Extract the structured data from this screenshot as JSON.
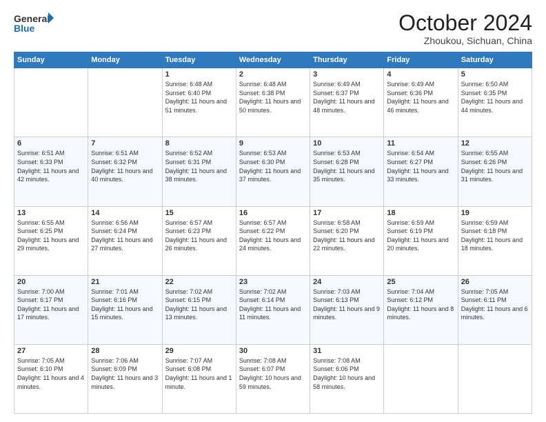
{
  "header": {
    "logo_line1": "General",
    "logo_line2": "Blue",
    "month": "October 2024",
    "location": "Zhoukou, Sichuan, China"
  },
  "days_of_week": [
    "Sunday",
    "Monday",
    "Tuesday",
    "Wednesday",
    "Thursday",
    "Friday",
    "Saturday"
  ],
  "weeks": [
    [
      {
        "day": "",
        "info": ""
      },
      {
        "day": "",
        "info": ""
      },
      {
        "day": "1",
        "info": "Sunrise: 6:48 AM\nSunset: 6:40 PM\nDaylight: 11 hours and 51 minutes."
      },
      {
        "day": "2",
        "info": "Sunrise: 6:48 AM\nSunset: 6:38 PM\nDaylight: 11 hours and 50 minutes."
      },
      {
        "day": "3",
        "info": "Sunrise: 6:49 AM\nSunset: 6:37 PM\nDaylight: 11 hours and 48 minutes."
      },
      {
        "day": "4",
        "info": "Sunrise: 6:49 AM\nSunset: 6:36 PM\nDaylight: 11 hours and 46 minutes."
      },
      {
        "day": "5",
        "info": "Sunrise: 6:50 AM\nSunset: 6:35 PM\nDaylight: 11 hours and 44 minutes."
      }
    ],
    [
      {
        "day": "6",
        "info": "Sunrise: 6:51 AM\nSunset: 6:33 PM\nDaylight: 11 hours and 42 minutes."
      },
      {
        "day": "7",
        "info": "Sunrise: 6:51 AM\nSunset: 6:32 PM\nDaylight: 11 hours and 40 minutes."
      },
      {
        "day": "8",
        "info": "Sunrise: 6:52 AM\nSunset: 6:31 PM\nDaylight: 11 hours and 38 minutes."
      },
      {
        "day": "9",
        "info": "Sunrise: 6:53 AM\nSunset: 6:30 PM\nDaylight: 11 hours and 37 minutes."
      },
      {
        "day": "10",
        "info": "Sunrise: 6:53 AM\nSunset: 6:28 PM\nDaylight: 11 hours and 35 minutes."
      },
      {
        "day": "11",
        "info": "Sunrise: 6:54 AM\nSunset: 6:27 PM\nDaylight: 11 hours and 33 minutes."
      },
      {
        "day": "12",
        "info": "Sunrise: 6:55 AM\nSunset: 6:26 PM\nDaylight: 11 hours and 31 minutes."
      }
    ],
    [
      {
        "day": "13",
        "info": "Sunrise: 6:55 AM\nSunset: 6:25 PM\nDaylight: 11 hours and 29 minutes."
      },
      {
        "day": "14",
        "info": "Sunrise: 6:56 AM\nSunset: 6:24 PM\nDaylight: 11 hours and 27 minutes."
      },
      {
        "day": "15",
        "info": "Sunrise: 6:57 AM\nSunset: 6:23 PM\nDaylight: 11 hours and 26 minutes."
      },
      {
        "day": "16",
        "info": "Sunrise: 6:57 AM\nSunset: 6:22 PM\nDaylight: 11 hours and 24 minutes."
      },
      {
        "day": "17",
        "info": "Sunrise: 6:58 AM\nSunset: 6:20 PM\nDaylight: 11 hours and 22 minutes."
      },
      {
        "day": "18",
        "info": "Sunrise: 6:59 AM\nSunset: 6:19 PM\nDaylight: 11 hours and 20 minutes."
      },
      {
        "day": "19",
        "info": "Sunrise: 6:59 AM\nSunset: 6:18 PM\nDaylight: 11 hours and 18 minutes."
      }
    ],
    [
      {
        "day": "20",
        "info": "Sunrise: 7:00 AM\nSunset: 6:17 PM\nDaylight: 11 hours and 17 minutes."
      },
      {
        "day": "21",
        "info": "Sunrise: 7:01 AM\nSunset: 6:16 PM\nDaylight: 11 hours and 15 minutes."
      },
      {
        "day": "22",
        "info": "Sunrise: 7:02 AM\nSunset: 6:15 PM\nDaylight: 11 hours and 13 minutes."
      },
      {
        "day": "23",
        "info": "Sunrise: 7:02 AM\nSunset: 6:14 PM\nDaylight: 11 hours and 11 minutes."
      },
      {
        "day": "24",
        "info": "Sunrise: 7:03 AM\nSunset: 6:13 PM\nDaylight: 11 hours and 9 minutes."
      },
      {
        "day": "25",
        "info": "Sunrise: 7:04 AM\nSunset: 6:12 PM\nDaylight: 11 hours and 8 minutes."
      },
      {
        "day": "26",
        "info": "Sunrise: 7:05 AM\nSunset: 6:11 PM\nDaylight: 11 hours and 6 minutes."
      }
    ],
    [
      {
        "day": "27",
        "info": "Sunrise: 7:05 AM\nSunset: 6:10 PM\nDaylight: 11 hours and 4 minutes."
      },
      {
        "day": "28",
        "info": "Sunrise: 7:06 AM\nSunset: 6:09 PM\nDaylight: 11 hours and 3 minutes."
      },
      {
        "day": "29",
        "info": "Sunrise: 7:07 AM\nSunset: 6:08 PM\nDaylight: 11 hours and 1 minute."
      },
      {
        "day": "30",
        "info": "Sunrise: 7:08 AM\nSunset: 6:07 PM\nDaylight: 10 hours and 59 minutes."
      },
      {
        "day": "31",
        "info": "Sunrise: 7:08 AM\nSunset: 6:06 PM\nDaylight: 10 hours and 58 minutes."
      },
      {
        "day": "",
        "info": ""
      },
      {
        "day": "",
        "info": ""
      }
    ]
  ]
}
